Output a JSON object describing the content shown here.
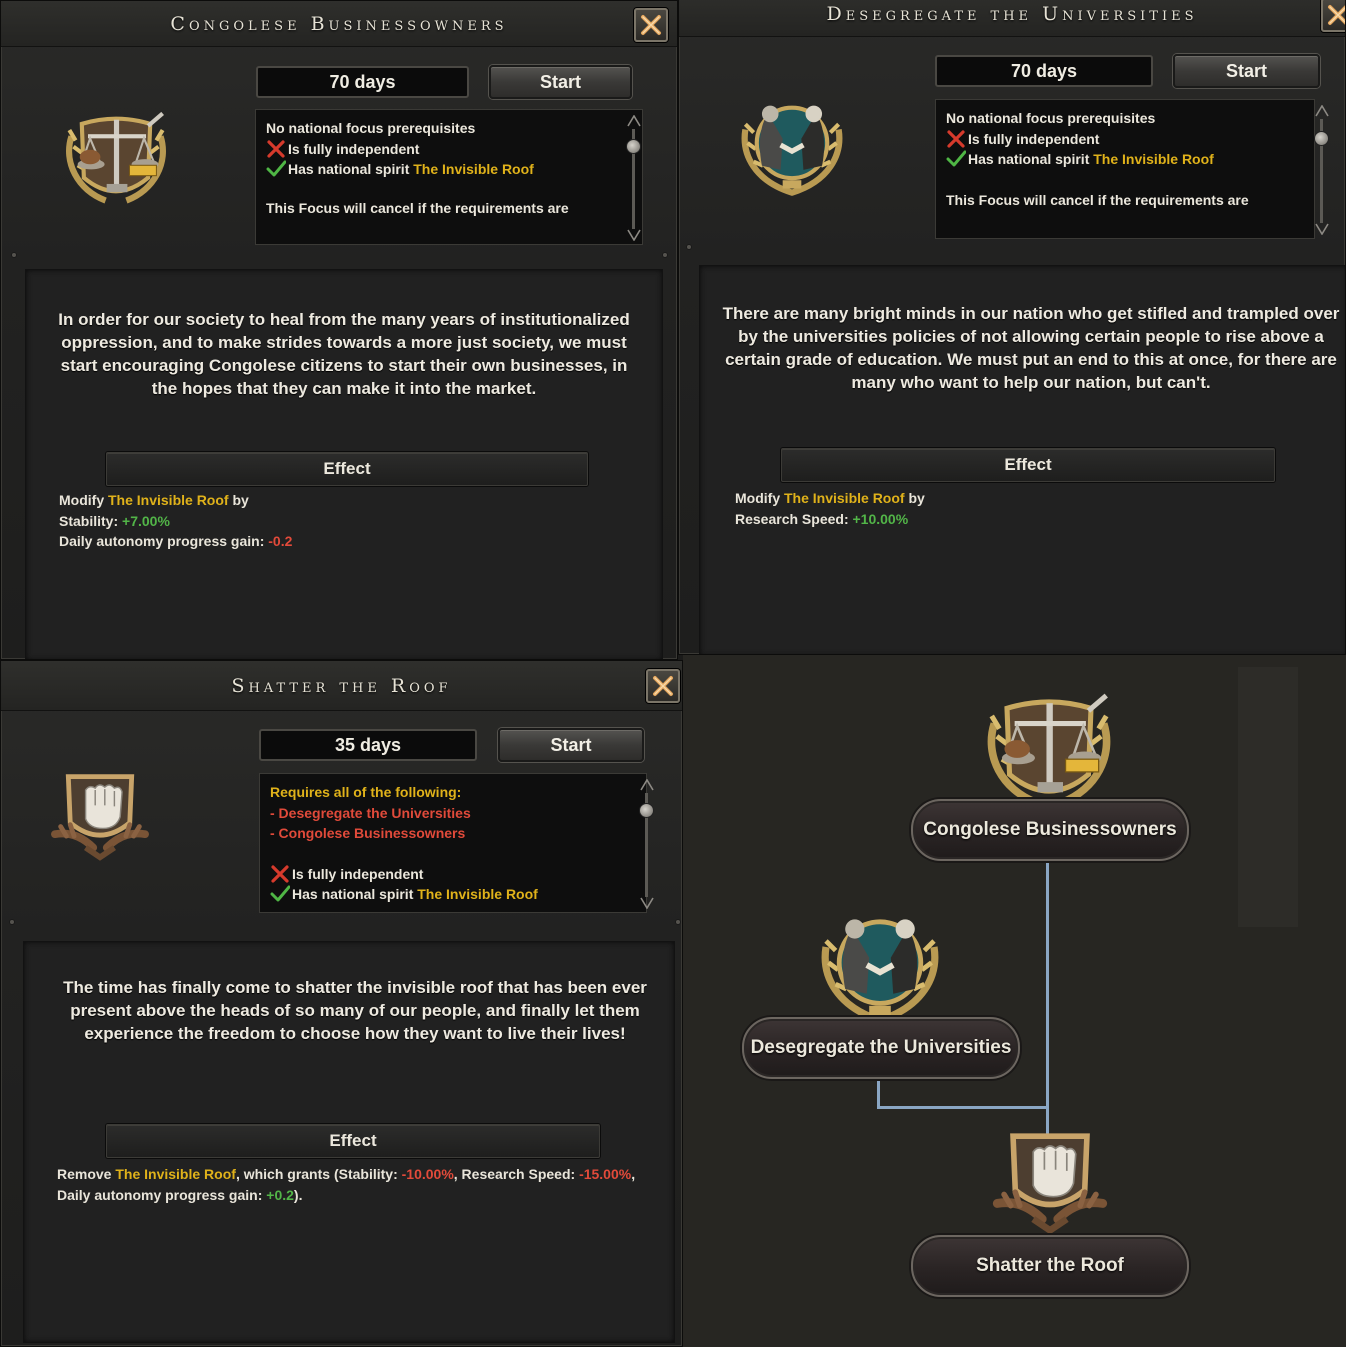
{
  "panels": [
    {
      "title": "Congolese Businessowners",
      "days": "70 days",
      "start_label": "Start",
      "requirements": {
        "header": "No national focus prerequisites",
        "line_independent": "Is fully independent",
        "line_spirit_prefix": "Has national spirit",
        "line_spirit_name": "The Invisible Roof",
        "cancel_note": "This Focus will cancel if the requirements are"
      },
      "description": "In order for our society to heal from the many years of institutionalized oppression, and to make strides towards a more just society, we must start encouraging Congolese citizens to start their own businesses, in the hopes that they can make it into the market.",
      "effect_label": "Effect",
      "effect": {
        "modify_prefix": "Modify",
        "spirit": "The Invisible Roof",
        "modify_suffix": "by",
        "stat1_label": "Stability:",
        "stat1_value": "+7.00%",
        "stat2_label": "Daily autonomy progress gain:",
        "stat2_value": "-0.2"
      }
    },
    {
      "title": "Desegregate the Universities",
      "days": "70 days",
      "start_label": "Start",
      "requirements": {
        "header": "No national focus prerequisites",
        "line_independent": "Is fully independent",
        "line_spirit_prefix": "Has national spirit",
        "line_spirit_name": "The Invisible Roof",
        "cancel_note": "This Focus will cancel if the requirements are"
      },
      "description": "There are many bright minds in our nation who get stifled and trampled over by the universities policies of not allowing certain people to rise above a certain grade of education. We must put an end to this at once, for there are many who want to help our nation, but can't.",
      "effect_label": "Effect",
      "effect": {
        "modify_prefix": "Modify",
        "spirit": "The Invisible Roof",
        "modify_suffix": "by",
        "stat1_label": "Research Speed:",
        "stat1_value": "+10.00%"
      }
    },
    {
      "title": "Shatter the Roof",
      "days": "35 days",
      "start_label": "Start",
      "requirements": {
        "header": "Requires all of the following:",
        "prereq1": "- Desegregate the Universities",
        "prereq2": "- Congolese Businessowners",
        "line_independent": "Is fully independent",
        "line_spirit_prefix": "Has national spirit",
        "line_spirit_name": "The Invisible Roof"
      },
      "description": "The time has finally come to shatter the invisible roof that has been ever present above the heads of so many of our people, and finally let them experience the freedom to choose how they want to live their lives!",
      "effect_label": "Effect",
      "effect": {
        "remove_prefix": "Remove",
        "spirit": "The Invisible Roof",
        "grants_text": ", which grants (Stability:",
        "stat1_value": "-10.00%",
        "sep1": ", Research Speed:",
        "stat2_value": "-15.00%",
        "sep2": ", Daily autonomy progress gain:",
        "stat3_value": "+0.2",
        "end": ")."
      }
    }
  ],
  "tree": {
    "node1": "Congolese Businessowners",
    "node2": "Desegregate the Universities",
    "node3": "Shatter the Roof"
  },
  "colors": {
    "gold": "#e0b21a",
    "positive": "#52b548",
    "negative": "#e24a3a",
    "connector": "#8aa6c4"
  },
  "icons": [
    "scales-icon",
    "handshake-icon",
    "raised-fist-icon",
    "close-icon",
    "cross-mark-icon",
    "check-mark-icon"
  ]
}
